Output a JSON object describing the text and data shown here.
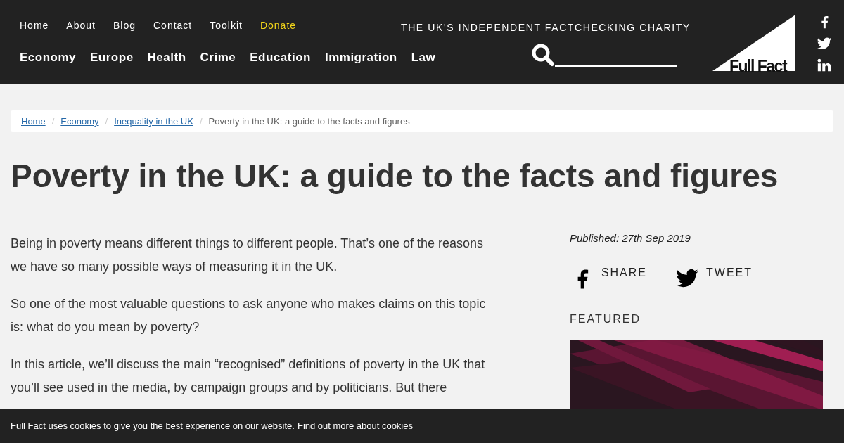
{
  "top_links": [
    {
      "label": "Home",
      "highlight": false
    },
    {
      "label": "About",
      "highlight": false
    },
    {
      "label": "Blog",
      "highlight": false
    },
    {
      "label": "Contact",
      "highlight": false
    },
    {
      "label": "Toolkit",
      "highlight": false
    },
    {
      "label": "Donate",
      "highlight": true
    }
  ],
  "topics": [
    "Economy",
    "Europe",
    "Health",
    "Crime",
    "Education",
    "Immigration",
    "Law"
  ],
  "tagline": "THE UK'S INDEPENDENT FACTCHECKING CHARITY",
  "logo": {
    "text": "Full Fact"
  },
  "breadcrumb_separator": "/",
  "breadcrumb": [
    {
      "label": "Home",
      "kind": "link"
    },
    {
      "label": "Economy",
      "kind": "link"
    },
    {
      "label": "Inequality in the UK",
      "kind": "link"
    },
    {
      "label": "Poverty in the UK: a guide to the facts and figures",
      "kind": "current"
    }
  ],
  "title": "Poverty in the UK: a guide to the facts and figures",
  "paragraphs": [
    "Being in poverty means different things to different people. That’s one of the reasons we have so many possible ways of measuring it in the UK.",
    "So one of the most valuable questions to ask anyone who makes claims on this topic is: what do you mean by poverty?",
    "In this article, we’ll discuss the main “recognised” definitions of poverty in the UK that you’ll see used in the media, by campaign groups and by politicians. But there"
  ],
  "published": "Published: 27th Sep 2019",
  "share": [
    {
      "kind": "facebook",
      "label": "SHARE"
    },
    {
      "kind": "twitter",
      "label": "TWEET"
    }
  ],
  "featured": {
    "heading": "FEATURED"
  },
  "cookie_bar": {
    "text": "Full Fact uses cookies to give you the best experience on our website.",
    "link": "Find out more about cookies"
  }
}
